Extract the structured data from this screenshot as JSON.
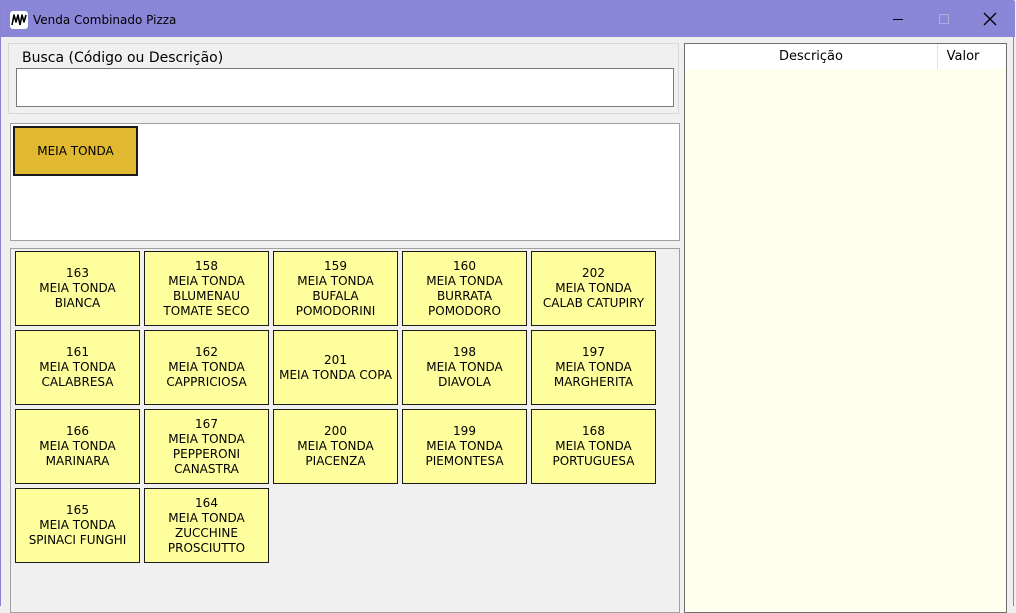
{
  "window": {
    "title": "Venda Combinado Pizza"
  },
  "search": {
    "label": "Busca (Código ou Descrição)",
    "value": "",
    "placeholder": ""
  },
  "category": {
    "label": "MEIA TONDA"
  },
  "products": [
    {
      "code": "163",
      "lines": [
        "MEIA TONDA",
        "BIANCA"
      ]
    },
    {
      "code": "158",
      "lines": [
        "MEIA TONDA",
        "BLUMENAU",
        "TOMATE SECO"
      ]
    },
    {
      "code": "159",
      "lines": [
        "MEIA TONDA",
        "BUFALA",
        "POMODORINI"
      ]
    },
    {
      "code": "160",
      "lines": [
        "MEIA TONDA",
        "BURRATA",
        "POMODORO"
      ]
    },
    {
      "code": "202",
      "lines": [
        "MEIA TONDA",
        "CALAB CATUPIRY"
      ]
    },
    {
      "code": "161",
      "lines": [
        "MEIA TONDA",
        "CALABRESA"
      ]
    },
    {
      "code": "162",
      "lines": [
        "MEIA TONDA",
        "CAPPRICIOSA"
      ]
    },
    {
      "code": "201",
      "lines": [
        "MEIA TONDA COPA"
      ]
    },
    {
      "code": "198",
      "lines": [
        "MEIA TONDA",
        "DIAVOLA"
      ]
    },
    {
      "code": "197",
      "lines": [
        "MEIA TONDA",
        "MARGHERITA"
      ]
    },
    {
      "code": "166",
      "lines": [
        "MEIA TONDA",
        "MARINARA"
      ]
    },
    {
      "code": "167",
      "lines": [
        "MEIA TONDA",
        "PEPPERONI",
        "CANASTRA"
      ]
    },
    {
      "code": "200",
      "lines": [
        "MEIA TONDA",
        "PIACENZA"
      ]
    },
    {
      "code": "199",
      "lines": [
        "MEIA TONDA",
        "PIEMONTESA"
      ]
    },
    {
      "code": "168",
      "lines": [
        "MEIA TONDA",
        "PORTUGUESA"
      ]
    },
    {
      "code": "165",
      "lines": [
        "MEIA TONDA",
        "SPINACI FUNGHI"
      ]
    },
    {
      "code": "164",
      "lines": [
        "MEIA TONDA",
        "ZUCCHINE",
        "PROSCIUTTO"
      ]
    }
  ],
  "order": {
    "columns": {
      "description": "Descrição",
      "value": "Valor"
    }
  },
  "colors": {
    "titlebar": "#8a87d8",
    "category_button": "#e1b930",
    "product_button": "#fffe9c",
    "order_background": "#fffff0"
  },
  "icons": {
    "app": "app-logo-icon",
    "minimize": "minimize-icon",
    "maximize": "maximize-icon",
    "close": "close-icon"
  }
}
